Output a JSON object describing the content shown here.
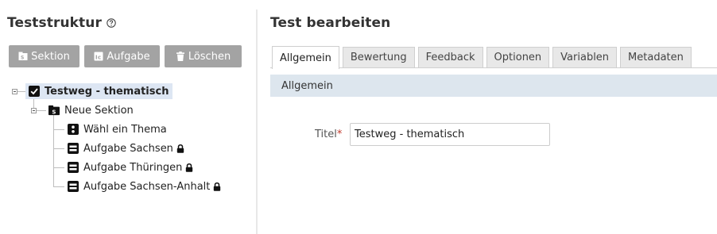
{
  "left_panel": {
    "title": "Teststruktur",
    "toolbar": {
      "section_label": "Sektion",
      "task_label": "Aufgabe",
      "delete_label": "Löschen"
    },
    "tree": {
      "root": "Testweg - thematisch",
      "section": "Neue Sektion",
      "items": [
        {
          "label": "Wähl ein Thema",
          "locked": false
        },
        {
          "label": "Aufgabe Sachsen",
          "locked": true
        },
        {
          "label": "Aufgabe Thüringen",
          "locked": true
        },
        {
          "label": "Aufgabe Sachsen-Anhalt",
          "locked": true
        }
      ]
    }
  },
  "right_panel": {
    "title": "Test bearbeiten",
    "tabs": [
      "Allgemein",
      "Bewertung",
      "Feedback",
      "Optionen",
      "Variablen",
      "Metadaten"
    ],
    "active_tab": "Allgemein",
    "section_title": "Allgemein",
    "form": {
      "title_label": "Titel",
      "required_marker": "*",
      "title_value": "Testweg - thematisch"
    }
  },
  "colors": {
    "button_bg": "#a3a3a3",
    "selected_node_bg": "#dde6f3",
    "section_head_bg": "#dde6ee",
    "required": "#c0392b"
  }
}
